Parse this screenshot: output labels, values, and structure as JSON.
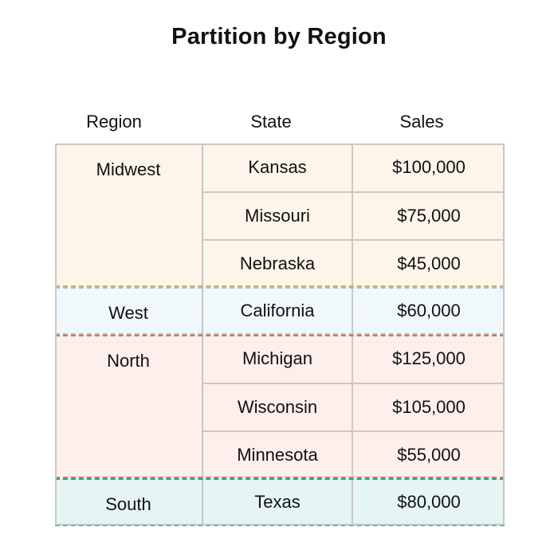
{
  "title": "Partition by Region",
  "headers": {
    "region": "Region",
    "state": "State",
    "sales": "Sales"
  },
  "groups": [
    {
      "region": "Midwest",
      "bg": "#fdf4ea",
      "outline": "#f5a33a",
      "rows": [
        {
          "state": "Kansas",
          "sales": "$100,000"
        },
        {
          "state": "Missouri",
          "sales": "$75,000"
        },
        {
          "state": "Nebraska",
          "sales": "$45,000"
        }
      ]
    },
    {
      "region": "West",
      "bg": "#f1f8fb",
      "outline": "#7ccbe3",
      "rows": [
        {
          "state": "California",
          "sales": "$60,000"
        }
      ]
    },
    {
      "region": "North",
      "bg": "#fdefec",
      "outline": "#f06a3f",
      "rows": [
        {
          "state": "Michigan",
          "sales": "$125,000"
        },
        {
          "state": "Wisconsin",
          "sales": "$105,000"
        },
        {
          "state": "Minnesota",
          "sales": "$55,000"
        }
      ]
    },
    {
      "region": "South",
      "bg": "#e5f5f3",
      "outline": "#1aa99a",
      "rows": [
        {
          "state": "Texas",
          "sales": "$80,000"
        }
      ]
    }
  ]
}
